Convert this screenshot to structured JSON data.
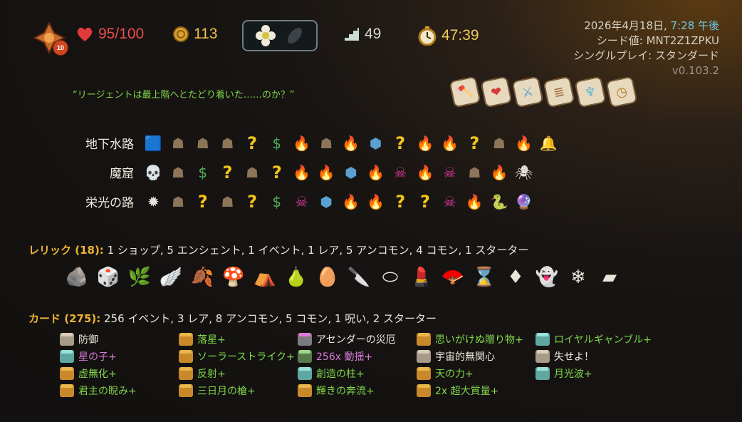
{
  "topbar": {
    "ascension": "10",
    "hp": "95/100",
    "gold": "113",
    "floor": "49",
    "time": "47:39",
    "potions": [
      "flower-potion-icon",
      "empty-potion-slot-icon"
    ],
    "info": {
      "date_prefix": "2026年4月18日, ",
      "time_of_day": "7:28 午後",
      "seed": "シード値: MNT2Z1ZPKU",
      "mode": "シングルプレイ: スタンダード",
      "version": "v0.103.2"
    }
  },
  "quote": "“リージェントは最上階へとたどり着いた……のか？”",
  "blessings": [
    "axe-icon",
    "heart-icon",
    "blade-icon",
    "scroll-stack-icon",
    "figure-icon",
    "clock-icon"
  ],
  "acts": [
    {
      "name": "地下水路",
      "nodes": [
        "boss-slime",
        "monster",
        "monster",
        "monster",
        "unknown",
        "shop",
        "rest",
        "monster",
        "rest",
        "chest",
        "unknown",
        "rest",
        "rest",
        "unknown",
        "monster",
        "rest",
        "boss-bell"
      ]
    },
    {
      "name": "魔窟",
      "nodes": [
        "boss-skull",
        "monster",
        "shop",
        "unknown",
        "monster",
        "unknown-elite",
        "rest",
        "rest",
        "chest",
        "rest",
        "elite",
        "rest",
        "elite",
        "monster",
        "rest",
        "boss-spider"
      ]
    },
    {
      "name": "栄光の路",
      "nodes": [
        "boss-spiky",
        "monster",
        "unknown",
        "monster",
        "unknown",
        "shop",
        "elite",
        "chest",
        "rest",
        "rest",
        "unknown",
        "unknown",
        "elite",
        "rest",
        "boss-eel",
        "boss-orb"
      ]
    }
  ],
  "relics": {
    "label": "レリック (18):",
    "summary": " 1 ショップ,  5 エンシェント, 1 イベント, 1 レア, 5 アンコモン, 4 コモン, 1 スターター",
    "items": [
      "crystal-rock-icon",
      "dice-icon",
      "green-bush-icon",
      "winged-boot-icon",
      "golden-leaves-icon",
      "mushroom-icon",
      "tent-icon",
      "pear-icon",
      "dark-egg-icon",
      "cleaver-icon",
      "stone-icon",
      "lipstick-icon",
      "fan-icon",
      "hourglass-icon",
      "red-pillow-icon",
      "blue-ghost-icon",
      "blue-crystal-icon",
      "anvil-icon"
    ]
  },
  "cards": {
    "label": "カード (275):",
    "summary": " 256 イベント, 3 レア, 8 アンコモン, 5 コモン, 1 呪い, 2 スターター",
    "items": [
      {
        "name": "防御",
        "kind": "skill",
        "color": "white"
      },
      {
        "name": "落星+",
        "kind": "atk",
        "color": "green"
      },
      {
        "name": "アセンダーの災厄",
        "kind": "curse",
        "color": "white"
      },
      {
        "name": "思いがけぬ贈り物+",
        "kind": "atk",
        "color": "green"
      },
      {
        "name": "ロイヤルギャンブル+",
        "kind": "power",
        "color": "green"
      },
      {
        "name": "星の子+",
        "kind": "power",
        "color": "pink"
      },
      {
        "name": "ソーラーストライク+",
        "kind": "atk",
        "color": "green"
      },
      {
        "name": "256x 動揺+",
        "kind": "status",
        "color": "pink"
      },
      {
        "name": "宇宙的無関心",
        "kind": "skill",
        "color": "white"
      },
      {
        "name": "失せよ！",
        "kind": "skill",
        "color": "white"
      },
      {
        "name": "虚無化+",
        "kind": "atk",
        "color": "green"
      },
      {
        "name": "反射+",
        "kind": "atk",
        "color": "green"
      },
      {
        "name": "創造の柱+",
        "kind": "power",
        "color": "green"
      },
      {
        "name": "天の力+",
        "kind": "atk",
        "color": "green"
      },
      {
        "name": "月光波+",
        "kind": "power",
        "color": "green"
      },
      {
        "name": "君主の睨み+",
        "kind": "atk",
        "color": "green"
      },
      {
        "name": "三日月の槍+",
        "kind": "atk",
        "color": "green"
      },
      {
        "name": "輝きの奔流+",
        "kind": "atk",
        "color": "green"
      },
      {
        "name": "2x 超大質量+",
        "kind": "atk",
        "color": "green"
      }
    ]
  },
  "colors": {
    "hp": "#e9504a",
    "gold": "#f0c04a",
    "quote": "#7fd74a",
    "section_label": "#f0b431",
    "upgraded_card": "#7fd74a",
    "special_card": "#d87ad8"
  }
}
